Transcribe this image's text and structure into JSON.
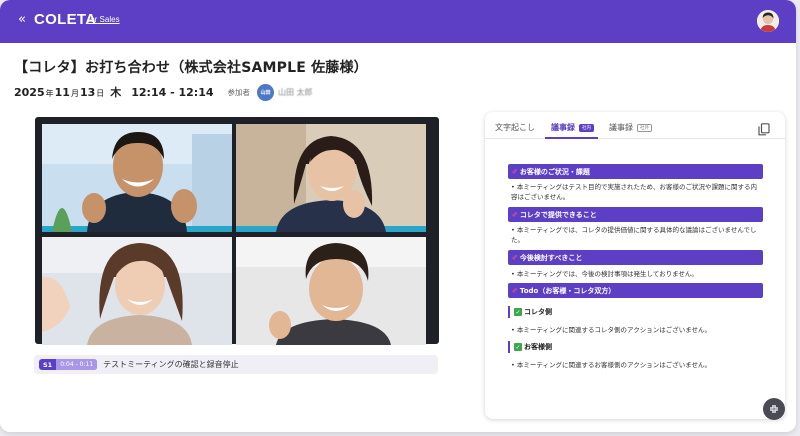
{
  "header": {
    "collapse_glyph": "«",
    "brand": "COLETA",
    "brand_sub": "for Sales"
  },
  "meeting": {
    "title": "【コレタ】お打ち合わせ（株式会社SAMPLE 佐藤様）",
    "year": "2025",
    "year_unit": "年",
    "month": "11",
    "month_unit": "月",
    "day": "13",
    "day_unit": "日",
    "weekday": "木",
    "time": "12:14 - 12:14",
    "participants_label": "参加者",
    "participant_initials": "山田",
    "participant_name": "山田 太郎"
  },
  "segment": {
    "speaker": "S1",
    "time": "0:04 - 0:11",
    "text": "テストミーティングの確認と録音停止"
  },
  "panel": {
    "tabs": [
      {
        "label": "文字起こし",
        "tag": ""
      },
      {
        "label": "議事録",
        "tag": "社内"
      },
      {
        "label": "議事録",
        "tag": "社外"
      }
    ],
    "sections": [
      {
        "title": "お客様のご状況・課題",
        "bullet": "本ミーティングはテスト目的で実施されたため、お客様のご状況や課題に関する内容はございません。"
      },
      {
        "title": "コレタで提供できること",
        "bullet": "本ミーティングでは、コレタの提供価値に関する具体的な議論はございませんでした。"
      },
      {
        "title": "今後検討すべきこと",
        "bullet": "本ミーティングでは、今後の検討事項は発生しておりません。"
      },
      {
        "title": "Todo（お客様・コレタ双方）"
      }
    ],
    "todo": [
      {
        "label": "コレタ側",
        "bullet": "本ミーティングに関連するコレタ側のアクションはございません。"
      },
      {
        "label": "お客様側",
        "bullet": "本ミーティングに関連するお客様側のアクションはございません。"
      }
    ]
  },
  "colors": {
    "brand": "#5c3fc4",
    "pin": "#ff5a7a",
    "check": "#3ca64b"
  },
  "icons": [
    "chevron-double-left-icon",
    "avatar",
    "copy-icon",
    "pin-icon",
    "check-icon",
    "collapse-icon"
  ]
}
